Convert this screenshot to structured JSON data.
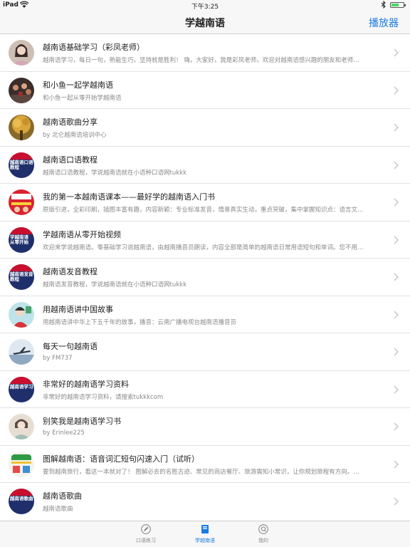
{
  "status_bar": {
    "carrier": "iPad",
    "time": "下午3:25",
    "battery_level": 0.6
  },
  "nav_bar": {
    "title": "学越南语",
    "right_button": "播放器"
  },
  "colors": {
    "accent": "#1b7be0",
    "badge_red": "#c8102e",
    "badge_navy": "#1f2f6b"
  },
  "items": [
    {
      "title": "越南语基础学习（彩凤老师）",
      "subtitle": "越南语学习，每日一句，熟能生巧，坚持就是胜利！ 嗨，大家好，我是彩凤老师，欢迎对越南语感兴趣的朋友和老师…",
      "avatar": "portrait-photo"
    },
    {
      "title": "和小鱼一起学越南语",
      "subtitle": "和小鱼一起从零开始学越南语",
      "avatar": "crowd-photo"
    },
    {
      "title": "越南语歌曲分享",
      "subtitle": "by 北仑越南语培训中心",
      "avatar": "golden-tree-photo"
    },
    {
      "title": "越南语口语教程",
      "subtitle": "越南语口语教程，学说越南语就在小语种口语网tukkk",
      "avatar": "tukkk-badge",
      "badge": "越南语口语\n教程"
    },
    {
      "title": "我的第一本越南语课本——最好学的越南语入门书",
      "subtitle": "原版引进，全彩印刷，插图丰富有趣，内容新颖：专业标准发音，情景真实生动，重点突破，集中掌握知识点：语言文…",
      "avatar": "book-cover"
    },
    {
      "title": "学越南语从零开始视频",
      "subtitle": "欢迎来学说越南语。零基础学习说越南语，由越南播音员朗读，内容全部是简单的越南语日常用语短句和单词。您不用…",
      "avatar": "tukkk-badge",
      "badge": "学越南语\n从零开始"
    },
    {
      "title": "越南语发音教程",
      "subtitle": "越南语发音教程，学说越南语就在小语种口语网tukkk",
      "avatar": "tukkk-badge",
      "badge": "越南语发音\n教程"
    },
    {
      "title": "用越南语讲中国故事",
      "subtitle": "用越南语讲中华上下五千年的故事，播音：云南广播电视台越南语播音员",
      "avatar": "illustration"
    },
    {
      "title": "每天一句越南语",
      "subtitle": "by FM737",
      "avatar": "airplane-photo"
    },
    {
      "title": "非常好的越南语学习资料",
      "subtitle": "非常好的越南语学习资料，请搜索tukkkcom",
      "avatar": "tukkk-badge",
      "badge": "越南语学习"
    },
    {
      "title": "别笑我是越南语学习书",
      "subtitle": "by Erinlee225",
      "avatar": "painting"
    },
    {
      "title": "图解越南语：语音词汇短句闪速入门（试听）",
      "subtitle": "要到越南旅行，看这一本就对了！ 图解必去的名胜古迹、常见的商店餐厅、旅游需知小常识，让你规划旅程有方向。…",
      "avatar": "book-cover-green"
    },
    {
      "title": "越南语歌曲",
      "subtitle": "越南语歌曲",
      "avatar": "tukkk-badge",
      "badge": "越南语歌曲"
    }
  ],
  "tabs": [
    {
      "label": "口语练习",
      "icon": "pencil-icon",
      "active": false
    },
    {
      "label": "学越南语",
      "icon": "book-icon",
      "active": true
    },
    {
      "label": "我的",
      "icon": "profile-icon",
      "active": false
    }
  ]
}
